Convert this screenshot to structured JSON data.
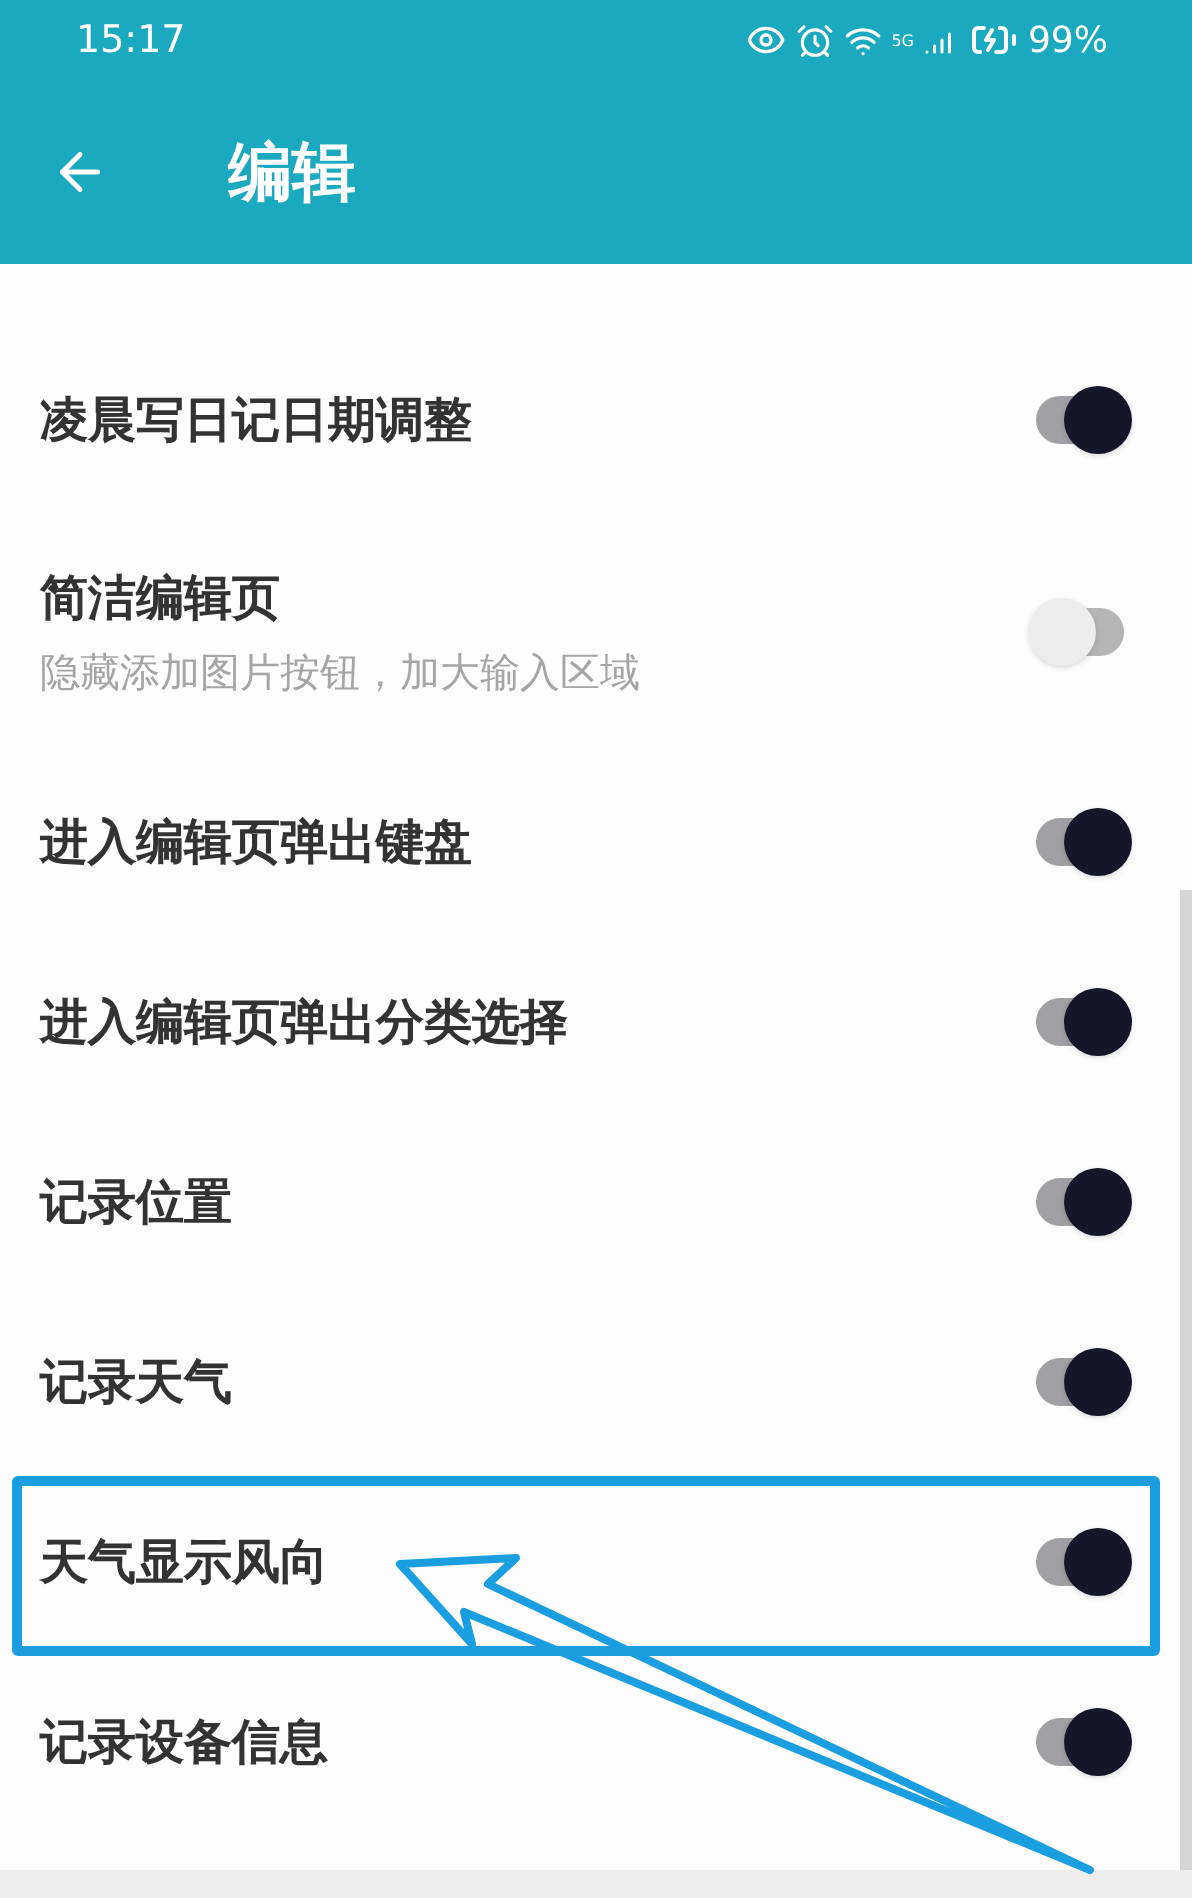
{
  "status_bar": {
    "time": "15:17",
    "network": "5G",
    "battery": "99%"
  },
  "header": {
    "title": "编辑"
  },
  "settings": [
    {
      "title": "凌晨写日记日期调整",
      "on": true,
      "highlighted": false
    },
    {
      "title": "简洁编辑页",
      "subtitle": "隐藏添加图片按钮，加大输入区域",
      "on": false,
      "highlighted": false
    },
    {
      "title": "进入编辑页弹出键盘",
      "on": true,
      "highlighted": false
    },
    {
      "title": "进入编辑页弹出分类选择",
      "on": true,
      "highlighted": false
    },
    {
      "title": "记录位置",
      "on": true,
      "highlighted": false
    },
    {
      "title": "记录天气",
      "on": true,
      "highlighted": false
    },
    {
      "title": "天气显示风向",
      "on": true,
      "highlighted": true
    },
    {
      "title": "记录设备信息",
      "on": true,
      "highlighted": false
    }
  ]
}
